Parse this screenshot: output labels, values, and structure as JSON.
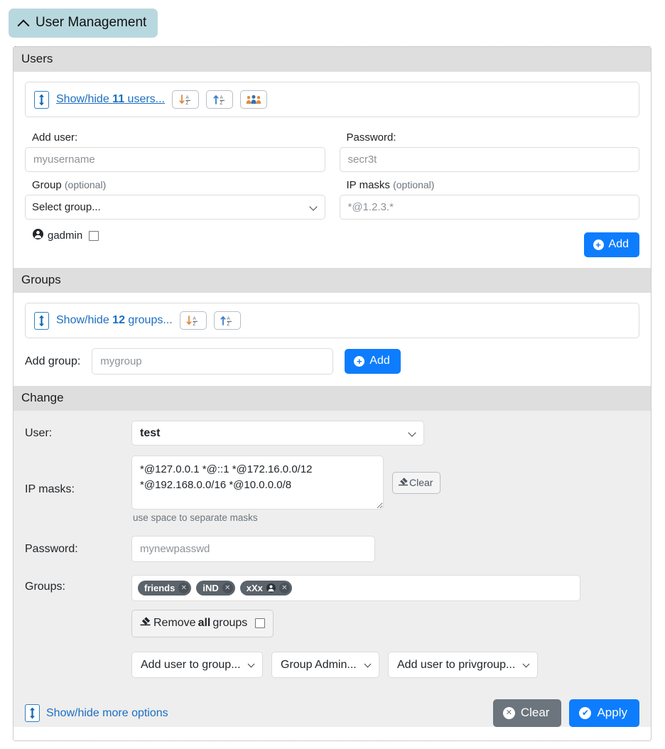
{
  "header": {
    "title": "User Management",
    "collapse_icon": "chevron-up-icon"
  },
  "users": {
    "section_title": "Users",
    "toggle": {
      "prefix": "Show/hide ",
      "count": "11",
      "suffix": " users...",
      "icon": "expand-collapse-icon"
    },
    "toolbar": [
      {
        "name": "sort-descending-alpha-icon",
        "title": "Sort Z-A"
      },
      {
        "name": "sort-ascending-alpha-icon",
        "title": "Sort A-Z"
      },
      {
        "name": "users-group-icon",
        "title": "Show groups"
      }
    ],
    "add_user_label": "Add user:",
    "add_user_placeholder": "myusername",
    "password_label": "Password:",
    "password_placeholder": "secr3t",
    "group_label": "Group",
    "group_optional": "(optional)",
    "group_selected": "Select group...",
    "group_options": [
      "Select group..."
    ],
    "ipmasks_label": "IP masks",
    "ipmasks_optional": "(optional)",
    "ipmasks_placeholder": "*@1.2.3.*",
    "gadmin_label": "gadmin",
    "gadmin_icon": "person-circle-icon",
    "gadmin_checked": false,
    "add_button": "Add",
    "add_button_icon": "plus-circle-icon"
  },
  "groups": {
    "section_title": "Groups",
    "toggle": {
      "prefix": "Show/hide ",
      "count": "12",
      "suffix": " groups...",
      "icon": "expand-collapse-icon"
    },
    "toolbar": [
      {
        "name": "sort-descending-alpha-icon",
        "title": "Sort Z-A"
      },
      {
        "name": "sort-ascending-alpha-icon",
        "title": "Sort A-Z"
      }
    ],
    "add_group_label": "Add group:",
    "add_group_placeholder": "mygroup",
    "add_button": "Add",
    "add_button_icon": "plus-circle-icon"
  },
  "change": {
    "section_title": "Change",
    "user_label": "User:",
    "user_selected": "test",
    "user_options": [
      "test"
    ],
    "ipmasks_label": "IP masks:",
    "ipmasks_value": "*@127.0.0.1 *@::1 *@172.16.0.0/12 *@192.168.0.0/16 *@10.0.0.0/8",
    "ipmasks_clear_label": "Clear",
    "ipmasks_clear_icon": "eraser-icon",
    "ipmasks_hint": "use space to separate masks",
    "password_label": "Password:",
    "password_placeholder": "mynewpasswd",
    "groups_label": "Groups:",
    "group_chips": [
      {
        "label": "friends",
        "has_admin_icon": false,
        "remove_icon": "remove-circle-icon"
      },
      {
        "label": "iND",
        "has_admin_icon": false,
        "remove_icon": "remove-circle-icon"
      },
      {
        "label": "xXx",
        "has_admin_icon": true,
        "admin_icon": "person-circle-icon",
        "remove_icon": "remove-circle-icon"
      }
    ],
    "remove_all": {
      "icon": "eraser-icon",
      "prefix": "Remove ",
      "strong": "all",
      "suffix": " groups",
      "checked": false
    },
    "selects": [
      {
        "name": "add-user-to-group-select",
        "selected": "Add user to group...",
        "options": [
          "Add user to group..."
        ]
      },
      {
        "name": "group-admin-select",
        "selected": "Group Admin...",
        "options": [
          "Group Admin..."
        ]
      },
      {
        "name": "add-user-to-privgroup-select",
        "selected": "Add user to privgroup...",
        "options": [
          "Add user to privgroup..."
        ]
      }
    ],
    "more_options": {
      "label": "Show/hide more options",
      "icon": "expand-collapse-icon"
    },
    "clear_button": "Clear",
    "clear_icon": "x-circle-icon",
    "apply_button": "Apply",
    "apply_icon": "check-circle-icon"
  },
  "colors": {
    "accent_blue": "#0d7dfd",
    "link_blue": "#1b6ec2",
    "badge_teal": "#b8d8df",
    "section_bar": "#dedede",
    "change_bg": "#eeeeee",
    "chip_gray": "#5b636b",
    "clear_gray": "#6c757d"
  }
}
